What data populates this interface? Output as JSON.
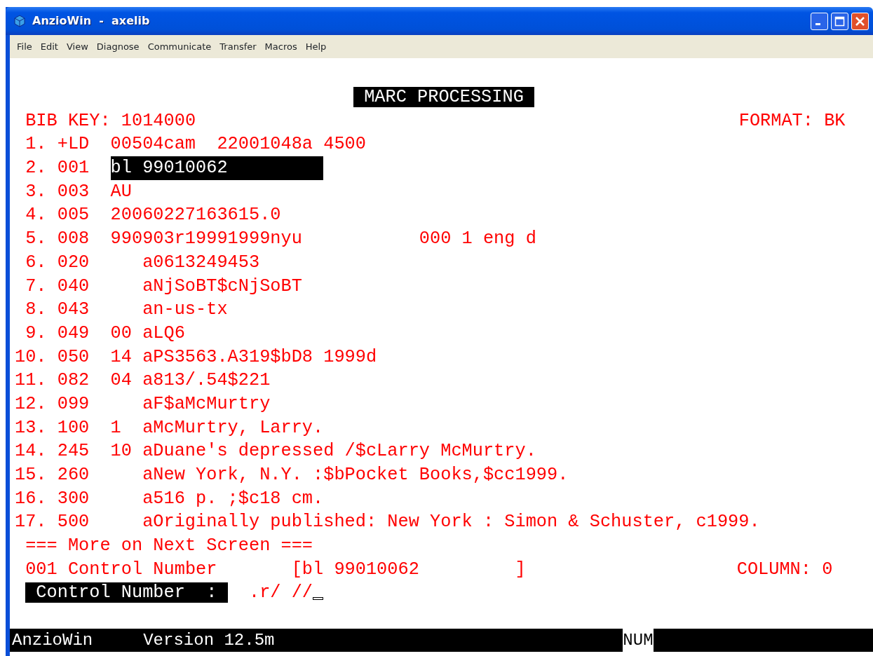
{
  "window": {
    "title": "AnzioWin  -  axelib"
  },
  "menu": [
    "File",
    "Edit",
    "View",
    "Diagnose",
    "Communicate",
    "Transfer",
    "Macros",
    "Help"
  ],
  "screen": {
    "heading": "MARC PROCESSING",
    "bib_key_label": "BIB KEY:",
    "bib_key": "1014000",
    "format_label": "FORMAT:",
    "format": "BK",
    "records": [
      {
        "num": "1.",
        "tag": "+LD",
        "kind": "control",
        "data": "00504cam  22001048a 4500",
        "selected": false
      },
      {
        "num": "2.",
        "tag": "001",
        "kind": "control",
        "data": "bl 99010062",
        "selected": true
      },
      {
        "num": "3.",
        "tag": "003",
        "kind": "control",
        "data": "AU",
        "selected": false
      },
      {
        "num": "4.",
        "tag": "005",
        "kind": "control",
        "data": "20060227163615.0",
        "selected": false
      },
      {
        "num": "5.",
        "tag": "008",
        "kind": "control",
        "data": "990903r19991999nyu           000 1 eng d",
        "selected": false
      },
      {
        "num": "6.",
        "tag": "020",
        "kind": "data",
        "data": "a0613249453",
        "selected": false
      },
      {
        "num": "7.",
        "tag": "040",
        "kind": "data",
        "data": "aNjSoBT$cNjSoBT",
        "selected": false
      },
      {
        "num": "8.",
        "tag": "043",
        "kind": "data",
        "data": "an-us-tx",
        "selected": false
      },
      {
        "num": "9.",
        "tag": "049",
        "kind": "data",
        "indicators": "00",
        "data": "aLQ6",
        "selected": false
      },
      {
        "num": "10.",
        "tag": "050",
        "kind": "data",
        "indicators": "14",
        "data": "aPS3563.A319$bD8 1999d",
        "selected": false
      },
      {
        "num": "11.",
        "tag": "082",
        "kind": "data",
        "indicators": "04",
        "data": "a813/.54$221",
        "selected": false
      },
      {
        "num": "12.",
        "tag": "099",
        "kind": "data",
        "data": "aF$aMcMurtry",
        "selected": false
      },
      {
        "num": "13.",
        "tag": "100",
        "kind": "data",
        "indicators": "1",
        "data": "aMcMurtry, Larry.",
        "selected": false
      },
      {
        "num": "14.",
        "tag": "245",
        "kind": "data",
        "indicators": "10",
        "data": "aDuane's depressed /$cLarry McMurtry.",
        "selected": false
      },
      {
        "num": "15.",
        "tag": "260",
        "kind": "data",
        "data": "aNew York, N.Y. :$bPocket Books,$cc1999.",
        "selected": false
      },
      {
        "num": "16.",
        "tag": "300",
        "kind": "data",
        "data": "a516 p. ;$c18 cm.",
        "selected": false
      },
      {
        "num": "17.",
        "tag": "500",
        "kind": "data",
        "data": "aOriginally published: New York : Simon & Schuster, c1999.",
        "selected": false
      }
    ],
    "more_notice": "=== More on Next Screen ===",
    "field_name": "001 Control Number",
    "field_value": "[bl 99010062         ]",
    "column_label": "COLUMN:",
    "column": "0",
    "prompt_label": "Control Number  :",
    "prompt_input": ".r/ //"
  },
  "status_bar": {
    "app": "AnzioWin",
    "version": "Version 12.5m",
    "num": "NUM"
  }
}
